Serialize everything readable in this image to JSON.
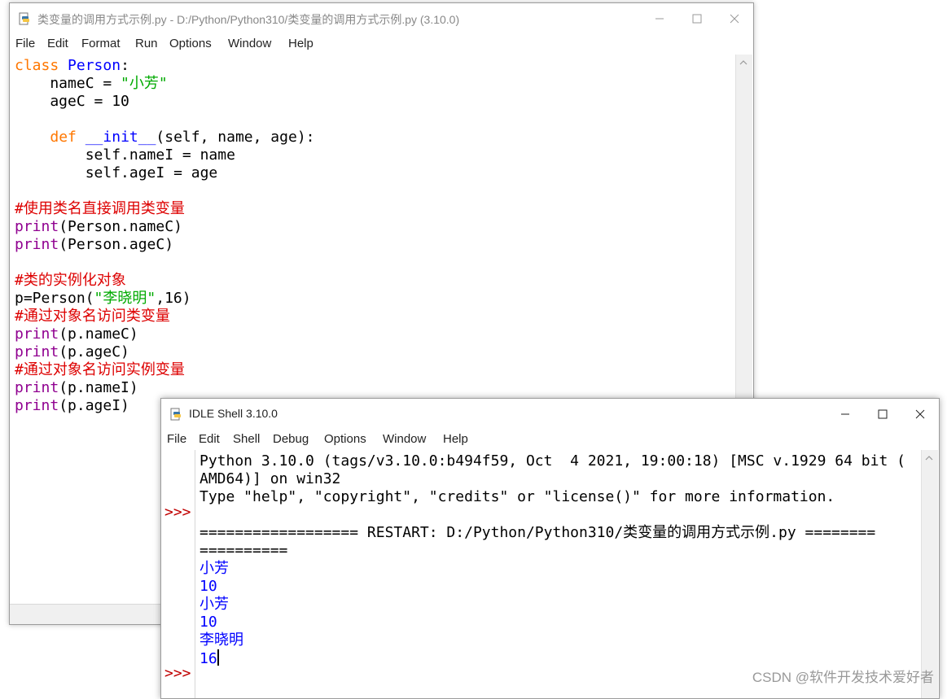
{
  "editor": {
    "title": "类变量的调用方式示例.py - D:/Python/Python310/类变量的调用方式示例.py (3.10.0)",
    "menu": [
      "File",
      "Edit",
      "Format",
      "Run",
      "Options",
      "Window",
      "Help"
    ],
    "code": {
      "l1_kw": "class",
      "l1_name": "Person",
      "l1_rest": ":",
      "l2_pre": "    nameC = ",
      "l2_str": "\"小芳\"",
      "l3": "    ageC = 10",
      "l4": "",
      "l5_pre": "    ",
      "l5_kw": "def",
      "l5_name": "__init__",
      "l5_rest": "(self, name, age):",
      "l6": "        self.nameI = name",
      "l7": "        self.ageI = age",
      "l8": "",
      "l9_com": "#使用类名直接调用类变量",
      "l10_bi": "print",
      "l10_rest": "(Person.nameC)",
      "l11_bi": "print",
      "l11_rest": "(Person.ageC)",
      "l12": "",
      "l13_com": "#类的实例化对象",
      "l14_pre": "p=Person(",
      "l14_str": "\"李晓明\"",
      "l14_rest": ",16)",
      "l15_com": "#通过对象名访问类变量",
      "l16_bi": "print",
      "l16_rest": "(p.nameC)",
      "l17_bi": "print",
      "l17_rest": "(p.ageC)",
      "l18_com": "#通过对象名访问实例变量",
      "l19_bi": "print",
      "l19_rest": "(p.nameI)",
      "l20_bi": "print",
      "l20_rest": "(p.ageI)"
    }
  },
  "shell": {
    "title": "IDLE Shell 3.10.0",
    "menu": [
      "File",
      "Edit",
      "Shell",
      "Debug",
      "Options",
      "Window",
      "Help"
    ],
    "prompt": ">>>",
    "banner1": "Python 3.10.0 (tags/v3.10.0:b494f59, Oct  4 2021, 19:00:18) [MSC v.1929 64 bit (",
    "banner2": "AMD64)] on win32",
    "banner3": "Type \"help\", \"copyright\", \"credits\" or \"license()\" for more information.",
    "restart1": "================== RESTART: D:/Python/Python310/类变量的调用方式示例.py ========",
    "restart2": "==========",
    "outputs": [
      "小芳",
      "10",
      "小芳",
      "10",
      "李晓明",
      "16"
    ]
  },
  "watermark": "CSDN @软件开发技术爱好者"
}
